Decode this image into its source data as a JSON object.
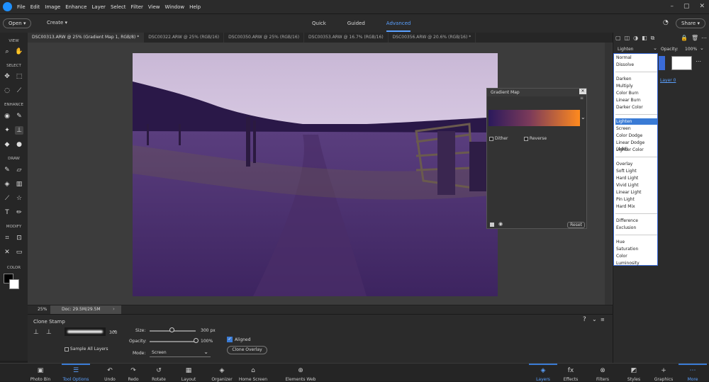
{
  "menu": {
    "items": [
      "File",
      "Edit",
      "Image",
      "Enhance",
      "Layer",
      "Select",
      "Filter",
      "View",
      "Window",
      "Help"
    ]
  },
  "toolbar": {
    "open_label": "Open",
    "create_label": "Create",
    "modes": [
      "Quick",
      "Guided",
      "Advanced"
    ],
    "share_label": "Share"
  },
  "tools": {
    "sections": [
      "VIEW",
      "SELECT",
      "ENHANCE",
      "DRAW",
      "MODIFY",
      "COLOR"
    ]
  },
  "tabs": [
    {
      "label": "DSC00313.ARW @ 25% (Gradient Map 1, RGB/8) *",
      "active": true
    },
    {
      "label": "DSC00322.ARW @ 25% (RGB/16)"
    },
    {
      "label": "DSC00350.ARW @ 25% (RGB/16)"
    },
    {
      "label": "DSC00353.ARW @ 16.7% (RGB/16)"
    },
    {
      "label": "DSC00356.ARW @ 20.6% (RGB/16) *"
    }
  ],
  "status": {
    "zoom": "25%",
    "doc": "Doc: 29.5M/29.5M"
  },
  "gradient_map": {
    "title": "Gradient Map",
    "dither": "Dither",
    "reverse": "Reverse",
    "reset": "Reset",
    "colors": [
      "#2b1a5c",
      "#7b3a5a",
      "#ff8a1e"
    ]
  },
  "layers": {
    "blend_mode": "Lighten",
    "opacity_label": "Opacity:",
    "opacity_value": "100%",
    "layer_name": "Layer 0"
  },
  "blend_modes": {
    "groups": [
      [
        "Normal",
        "Dissolve"
      ],
      [
        "Darken",
        "Multiply",
        "Color Burn",
        "Linear Burn",
        "Darker Color"
      ],
      [
        "Lighten",
        "Screen",
        "Color Dodge",
        "Linear Dodge (Add)",
        "Lighter Color"
      ],
      [
        "Overlay",
        "Soft Light",
        "Hard Light",
        "Vivid Light",
        "Linear Light",
        "Pin Light",
        "Hard Mix"
      ],
      [
        "Difference",
        "Exclusion"
      ],
      [
        "Hue",
        "Saturation",
        "Color",
        "Luminosity"
      ]
    ],
    "selected": "Lighten"
  },
  "tool_options": {
    "title": "Clone Stamp",
    "brush_size": "300",
    "sample_all": "Sample All Layers",
    "size_label": "Size:",
    "size_value": "300 px",
    "opacity_label": "Opacity:",
    "opacity_value": "100%",
    "mode_label": "Mode:",
    "mode_value": "Screen",
    "aligned": "Aligned",
    "clone_overlay": "Clone Overlay",
    "size_fraction": 0.48,
    "opacity_fraction": 1.0
  },
  "bottom": {
    "items": [
      {
        "label": "Photo Bin",
        "icon": "photo-bin-icon"
      },
      {
        "label": "Tool Options",
        "icon": "tool-options-icon",
        "active": true
      },
      {
        "label": "Undo",
        "icon": "undo-icon"
      },
      {
        "label": "Redo",
        "icon": "redo-icon"
      },
      {
        "label": "Rotate",
        "icon": "rotate-icon"
      },
      {
        "label": "Layout",
        "icon": "layout-icon"
      },
      {
        "label": "Organizer",
        "icon": "organizer-icon"
      },
      {
        "label": "Home Screen",
        "icon": "home-icon"
      },
      {
        "label": "Elements Web",
        "icon": "globe-icon"
      },
      {
        "label": "Layers",
        "icon": "layers-icon",
        "active": true
      },
      {
        "label": "Effects",
        "icon": "fx-icon"
      },
      {
        "label": "Filters",
        "icon": "filters-icon"
      },
      {
        "label": "Styles",
        "icon": "styles-icon"
      },
      {
        "label": "Graphics",
        "icon": "plus-icon"
      },
      {
        "label": "More",
        "icon": "more-icon",
        "active": true
      }
    ]
  }
}
